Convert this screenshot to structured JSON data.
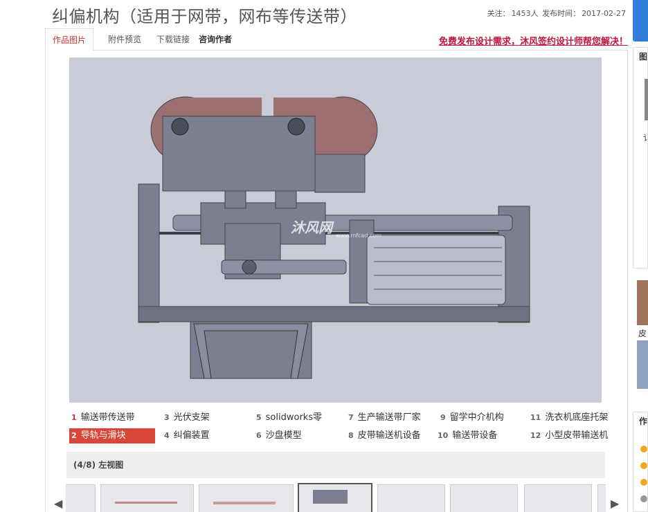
{
  "header": {
    "title": "纠偏机构（适用于网带，网布等传送带）",
    "follow_label": "关注：",
    "follow_count": "1453人",
    "date_label": "发布时间：",
    "date": "2017-02-27"
  },
  "tabs": [
    {
      "label": "作品图片"
    },
    {
      "label": "附件预览"
    },
    {
      "label": "下载链接"
    },
    {
      "label": "咨询作者"
    }
  ],
  "promo": "免费发布设计需求，沐风签约设计师帮您解决！",
  "viewer": {
    "watermark": "沐风网",
    "watermark_url": "www.mfcad.com"
  },
  "related": [
    {
      "num": "1",
      "label": "输送带传送带"
    },
    {
      "num": "2",
      "label": "导轨与滑块"
    },
    {
      "num": "3",
      "label": "光伏支架"
    },
    {
      "num": "4",
      "label": "纠偏装置"
    },
    {
      "num": "5",
      "label": "solidworks零"
    },
    {
      "num": "6",
      "label": "沙盘模型"
    },
    {
      "num": "7",
      "label": "生产输送带厂家"
    },
    {
      "num": "8",
      "label": "皮带输送机设备"
    },
    {
      "num": "9",
      "label": "留学中介机构"
    },
    {
      "num": "10",
      "label": "输送带设备"
    },
    {
      "num": "11",
      "label": "洗衣机底座托架"
    },
    {
      "num": "12",
      "label": "小型皮带输送机"
    }
  ],
  "caption": "(4/8) 左视图",
  "right": {
    "box1_title": "图",
    "box1_text": "讠",
    "box2_text": "皮",
    "box3_title": "作"
  },
  "colors": {
    "accent": "#d9463a",
    "promo": "#c0143c",
    "viewer_bg": "#c9ccd6",
    "blue": "#2f7fd8"
  }
}
